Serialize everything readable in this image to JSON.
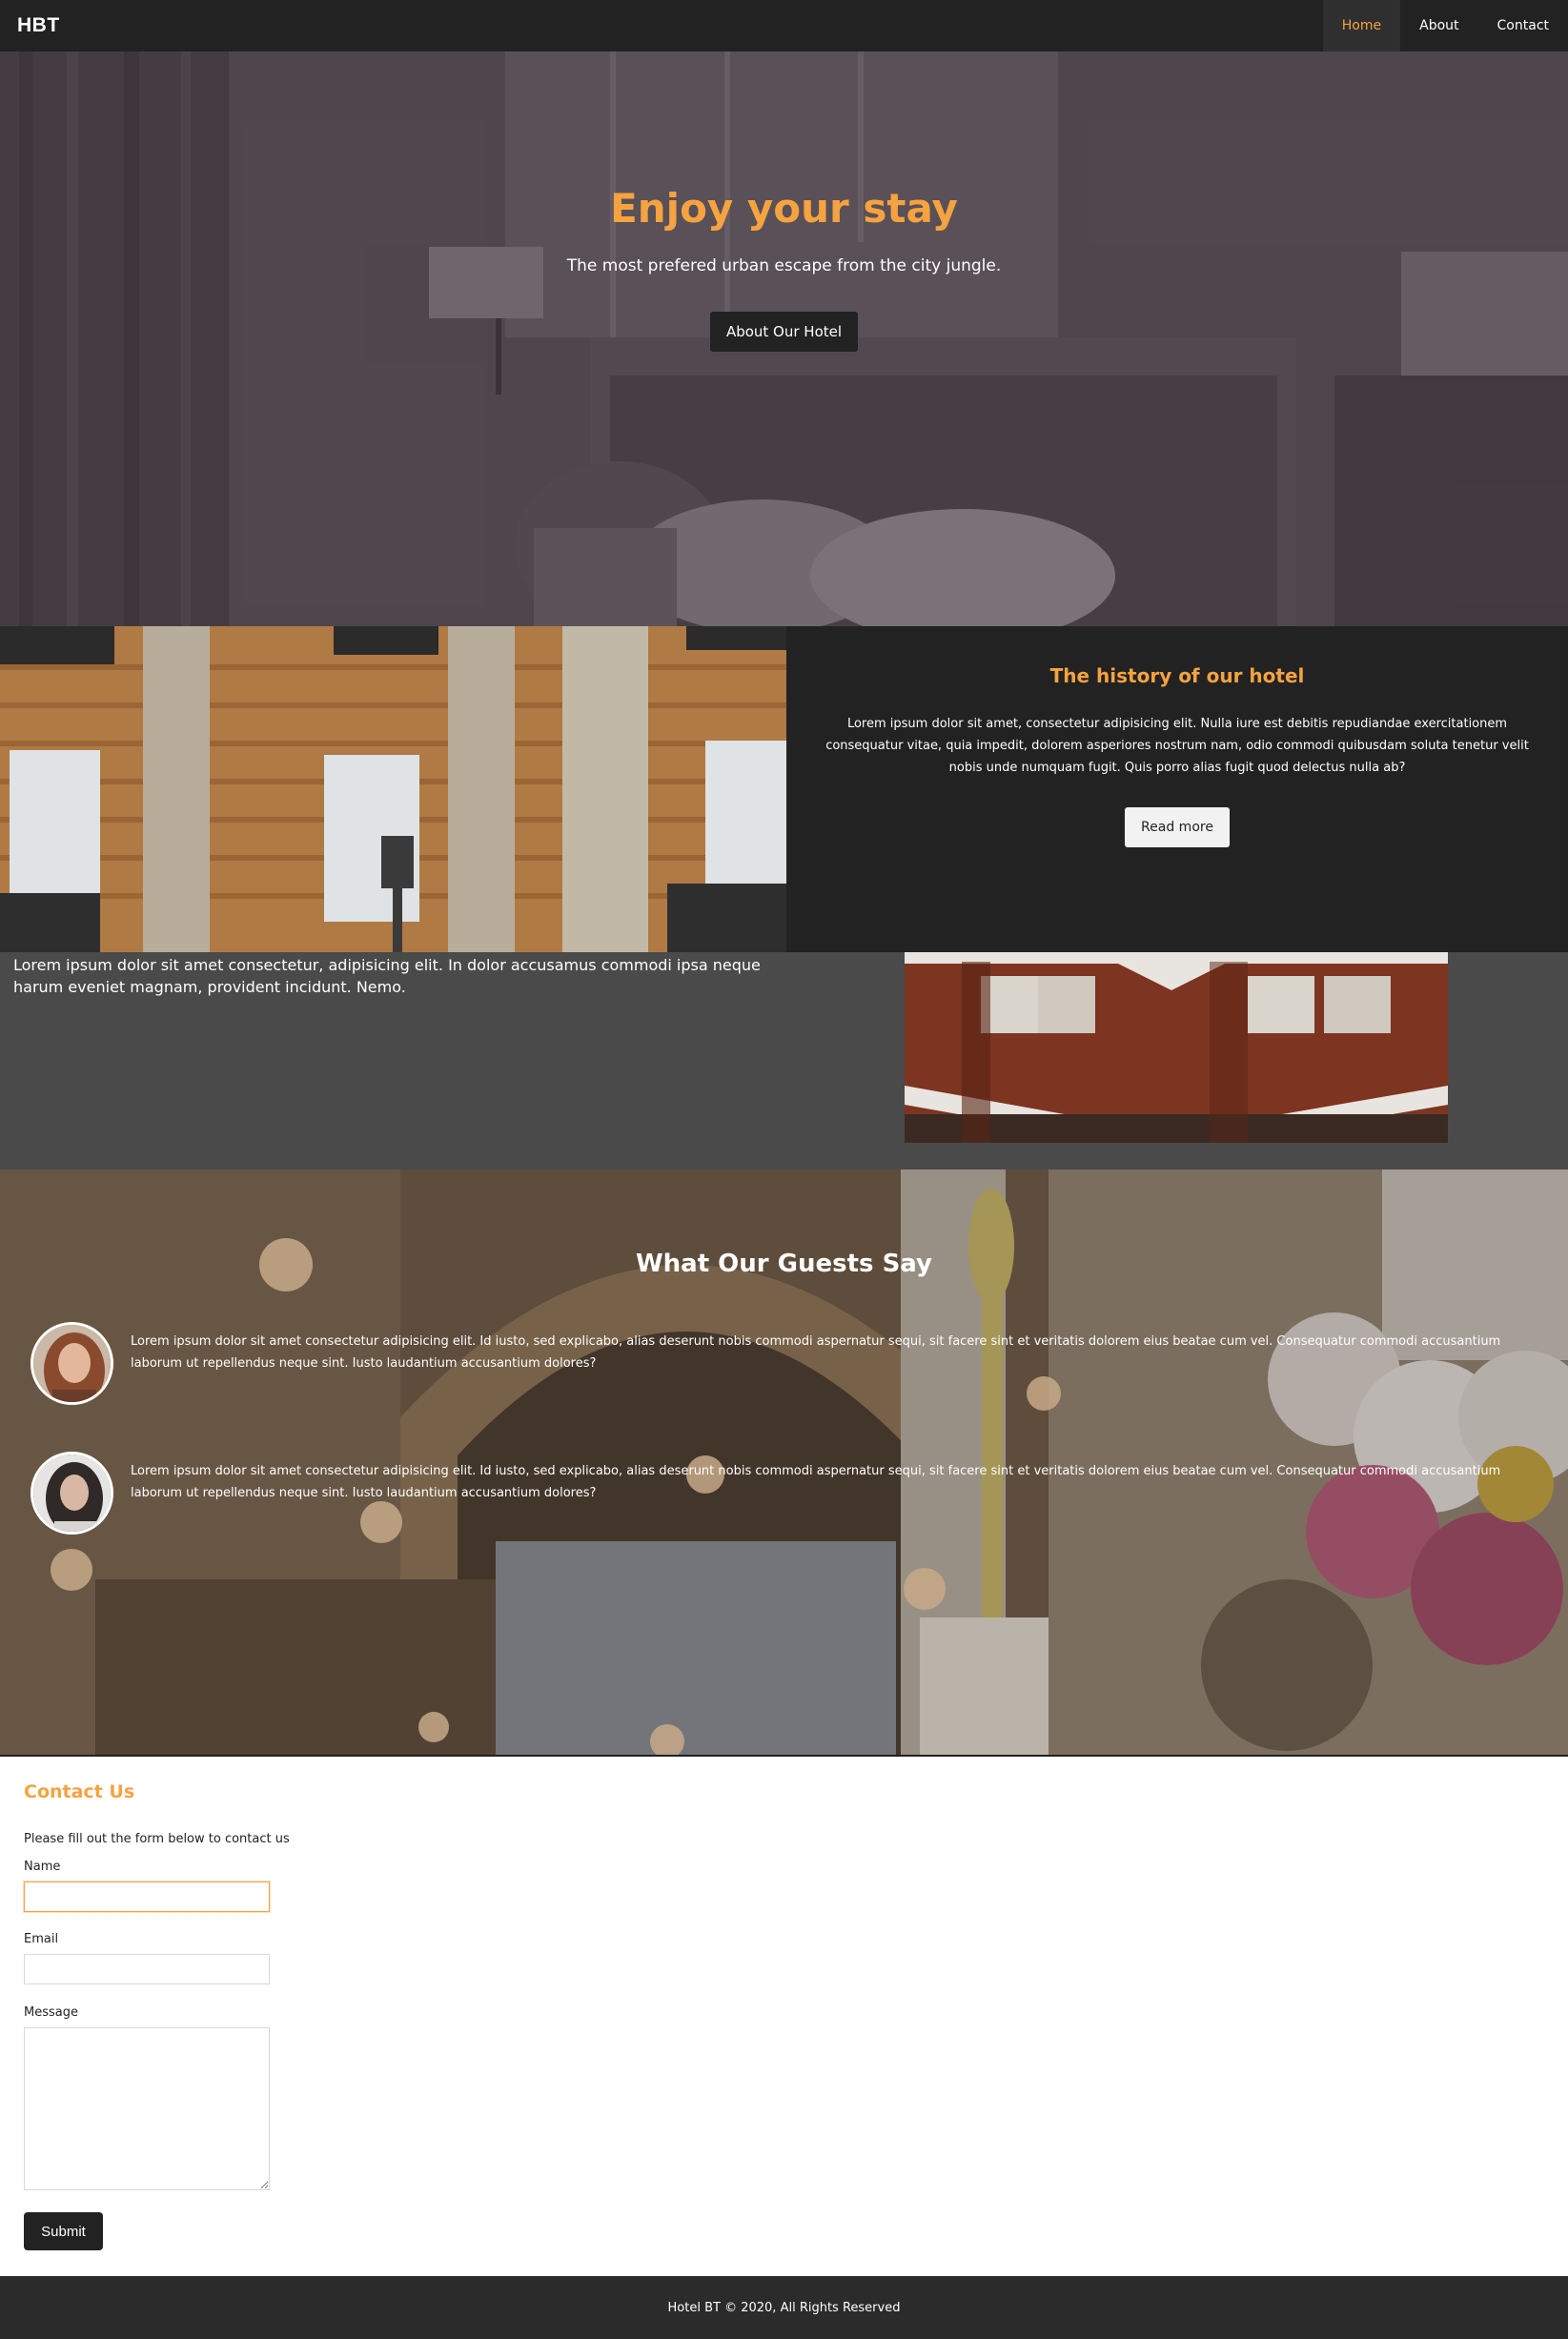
{
  "navbar": {
    "brand": "HBT",
    "links": [
      {
        "label": "Home",
        "active": true
      },
      {
        "label": "About",
        "active": false
      },
      {
        "label": "Contact",
        "active": false
      }
    ]
  },
  "hero": {
    "title": "Enjoy your stay",
    "subtitle": "The most prefered urban escape from the city jungle.",
    "button_label": "About Our Hotel"
  },
  "history": {
    "title": "The history of our hotel",
    "text": "Lorem ipsum dolor sit amet, consectetur adipisicing elit. Nulla iure est debitis repudiandae exercitationem consequatur vitae, quia impedit, dolorem asperiores nostrum nam, odio commodi quibusdam soluta tenetur velit nobis unde numquam fugit. Quis porro alias fugit quod delectus nulla ab?",
    "button_label": "Read more"
  },
  "strip": {
    "text": "Lorem ipsum dolor sit amet consectetur, adipisicing elit. In dolor accusamus commodi ipsa neque harum eveniet magnam, provident incidunt. Nemo."
  },
  "guests": {
    "title": "What Our Guests Say",
    "testimonials": [
      {
        "text": "Lorem ipsum dolor sit amet consectetur adipisicing elit. Id iusto, sed explicabo, alias deserunt nobis commodi aspernatur sequi, sit facere sint et veritatis dolorem eius beatae cum vel. Consequatur commodi accusantium laborum ut repellendus neque sint. Iusto laudantium accusantium dolores?"
      },
      {
        "text": "Lorem ipsum dolor sit amet consectetur adipisicing elit. Id iusto, sed explicabo, alias deserunt nobis commodi aspernatur sequi, sit facere sint et veritatis dolorem eius beatae cum vel. Consequatur commodi accusantium laborum ut repellendus neque sint. Iusto laudantium accusantium dolores?"
      }
    ]
  },
  "contact": {
    "title": "Contact Us",
    "intro": "Please fill out the form below to contact us",
    "name_label": "Name",
    "name_value": "",
    "email_label": "Email",
    "email_value": "",
    "message_label": "Message",
    "message_value": "",
    "submit_label": "Submit"
  },
  "footer": {
    "text": "Hotel BT © 2020, All Rights Reserved"
  },
  "colors": {
    "accent": "#f5a340",
    "dark": "#222222",
    "strip": "#4a4a4a",
    "footer": "#2b2b2b"
  }
}
